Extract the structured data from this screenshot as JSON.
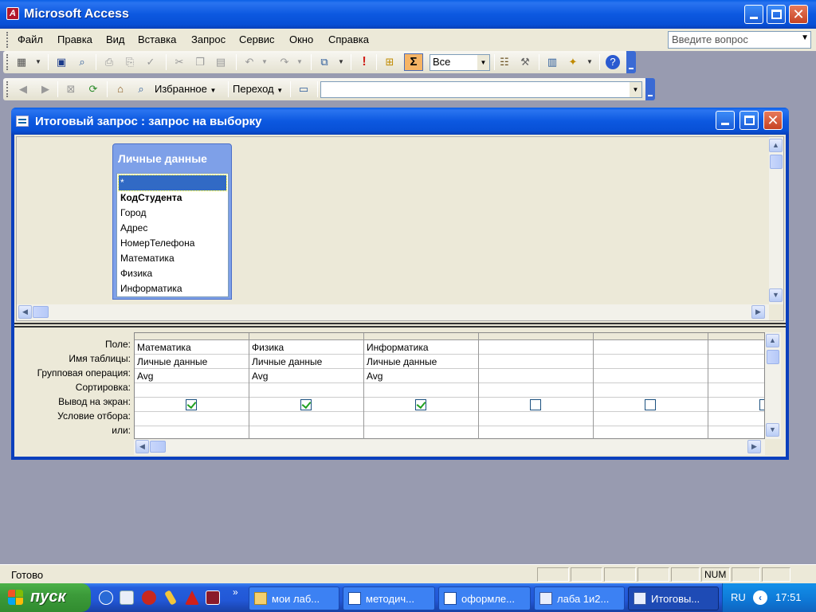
{
  "app": {
    "title": "Microsoft Access",
    "icon_label": "A"
  },
  "menu": {
    "items": [
      "Файл",
      "Правка",
      "Вид",
      "Вставка",
      "Запрос",
      "Сервис",
      "Окно",
      "Справка"
    ],
    "question_placeholder": "Введите вопрос"
  },
  "toolbar1": {
    "sigma": "Σ",
    "top_values": "Все",
    "icons": [
      "view-icon",
      "save-icon",
      "file-search-icon",
      "print-icon",
      "print-preview-icon",
      "spelling-icon",
      "cut-icon",
      "copy-icon",
      "paste-icon",
      "undo-icon",
      "redo-icon",
      "query-type-icon",
      "run-icon",
      "show-table-icon",
      "totals-icon",
      "properties-icon",
      "build-icon",
      "database-window-icon",
      "new-object-icon",
      "help-icon"
    ]
  },
  "toolbar2": {
    "favorites": "Избранное",
    "go": "Переход",
    "address_value": ""
  },
  "query_window": {
    "title": "Итоговый запрос : запрос на выборку"
  },
  "table": {
    "name": "Личные данные",
    "fields": [
      "*",
      "КодСтудента",
      "Город",
      "Адрес",
      "НомерТелефона",
      "Математика",
      "Физика",
      "Информатика"
    ],
    "selected_index": 0,
    "key_index": 1
  },
  "design_grid": {
    "row_labels": [
      "Поле:",
      "Имя таблицы:",
      "Групповая операция:",
      "Сортировка:",
      "Вывод на экран:",
      "Условие отбора:",
      "или:"
    ],
    "columns": [
      {
        "field": "Математика",
        "table": "Личные данные",
        "total": "Avg",
        "sort": "",
        "show": true,
        "criteria": "",
        "or": ""
      },
      {
        "field": "Физика",
        "table": "Личные данные",
        "total": "Avg",
        "sort": "",
        "show": true,
        "criteria": "",
        "or": ""
      },
      {
        "field": "Информатика",
        "table": "Личные данные",
        "total": "Avg",
        "sort": "",
        "show": true,
        "criteria": "",
        "or": ""
      },
      {
        "field": "",
        "table": "",
        "total": "",
        "sort": "",
        "show": false,
        "criteria": "",
        "or": ""
      },
      {
        "field": "",
        "table": "",
        "total": "",
        "sort": "",
        "show": false,
        "criteria": "",
        "or": ""
      },
      {
        "field": "",
        "table": "",
        "total": "",
        "sort": "",
        "show": false,
        "criteria": "",
        "or": ""
      }
    ]
  },
  "status": {
    "text": "Готово",
    "num": "NUM"
  },
  "taskbar": {
    "start": "пуск",
    "more": "»",
    "tasks": [
      {
        "label": "мои лаб...",
        "icon": "folder-icon",
        "active": false
      },
      {
        "label": "методич...",
        "icon": "word-icon",
        "active": false
      },
      {
        "label": "оформле...",
        "icon": "word-icon",
        "active": false
      },
      {
        "label": "лаба 1и2...",
        "icon": "access-db-icon",
        "active": false
      },
      {
        "label": "Итоговы...",
        "icon": "query-icon",
        "active": true
      }
    ],
    "lang": "RU",
    "clock": "17:51"
  },
  "colors": {
    "xp_blue": "#0c58e0",
    "window_face": "#ece9d8",
    "field_list_header": "#7ea0e8",
    "selection": "#316ac5",
    "start_green": "#3c9b3a"
  }
}
